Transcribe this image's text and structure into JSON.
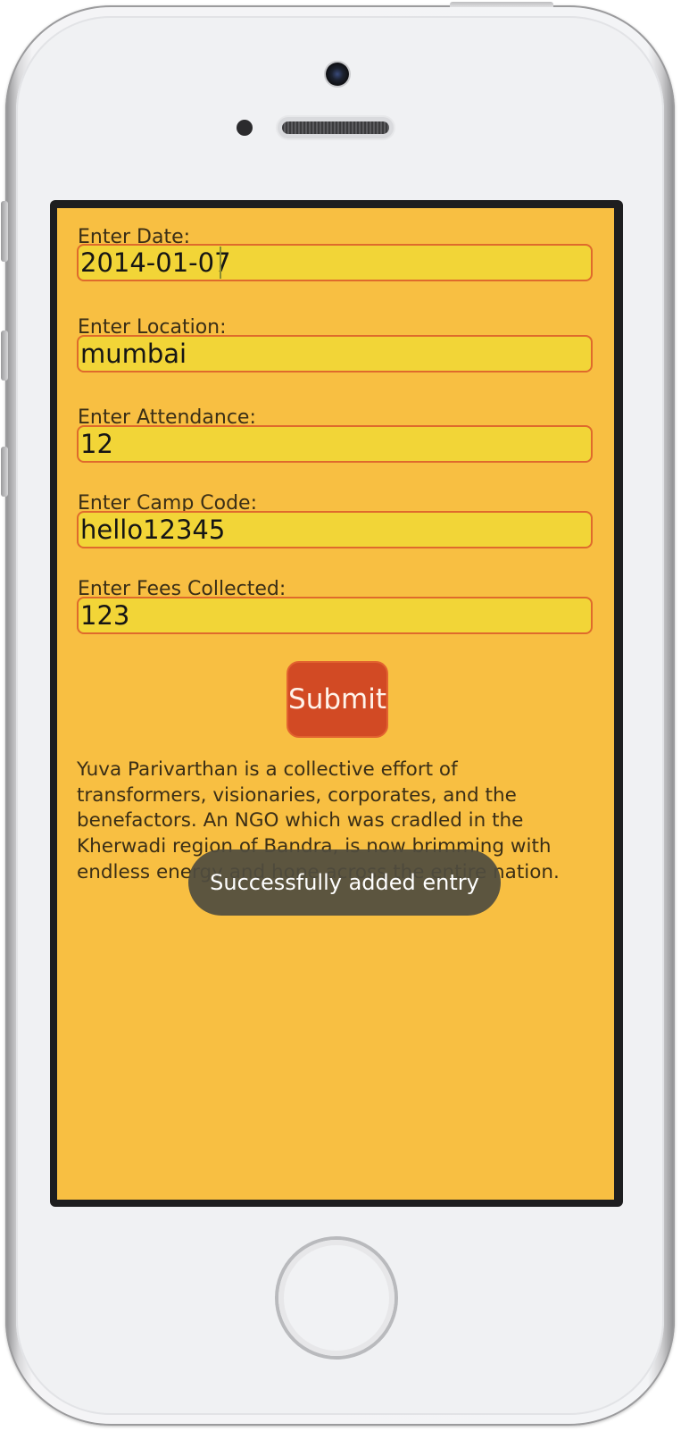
{
  "form": {
    "date_label": "Enter Date:",
    "date_value": "2014-01-07",
    "location_label": "Enter Location:",
    "location_value": "mumbai",
    "attendance_label": "Enter Attendance:",
    "attendance_value": "12",
    "camp_code_label": "Enter Camp Code:",
    "camp_code_value": "hello12345",
    "fees_label": "Enter Fees Collected:",
    "fees_value": "123",
    "submit_label": "Submit"
  },
  "about_text": "Yuva Parivarthan is a collective effort of transformers, visionaries, corporates, and the benefactors. An NGO which was cradled in the Kherwadi region of Bandra, is now brimming with endless energy and hope across the entire nation.",
  "toast": {
    "message": "Successfully added entry"
  },
  "colors": {
    "app_background": "#f8bf42",
    "input_background": "#f2d537",
    "input_border": "#df6a2c",
    "submit_button": "#d24a24",
    "toast_background": "#504c40"
  }
}
